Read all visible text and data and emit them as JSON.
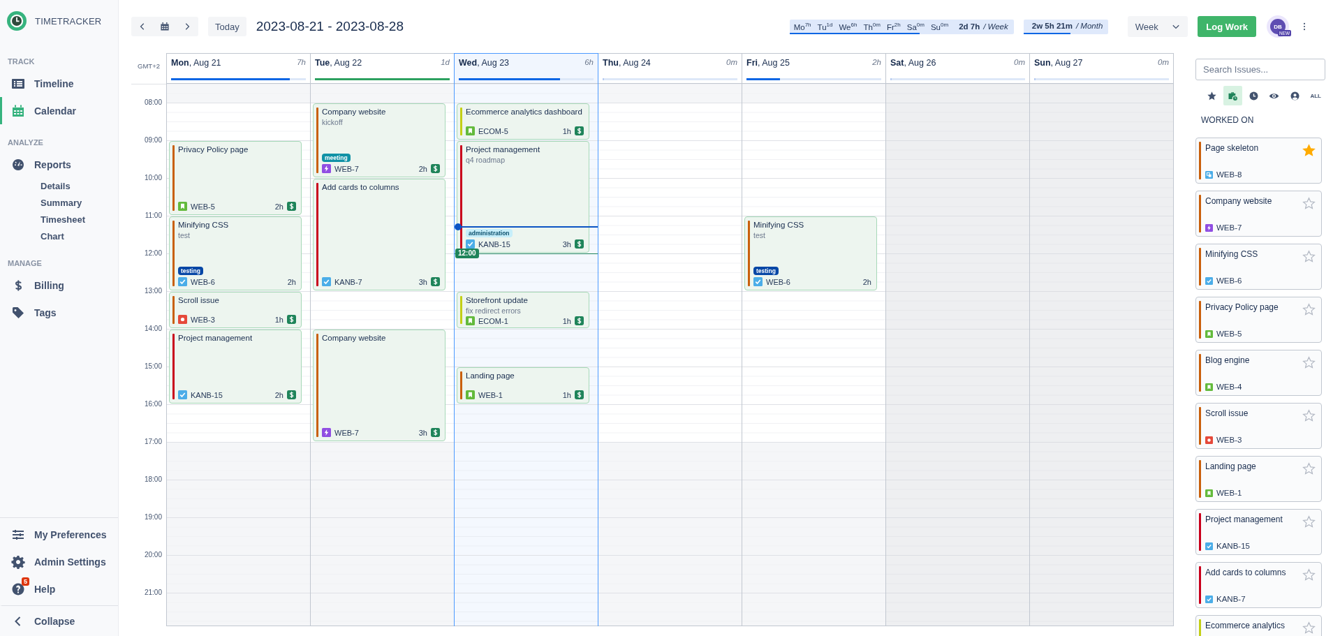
{
  "app": {
    "name": "TIMETRACKER"
  },
  "sidebar": {
    "sections": [
      {
        "title": "TRACK",
        "items": [
          {
            "label": "Timeline",
            "selected": false
          },
          {
            "label": "Calendar",
            "selected": true
          }
        ]
      },
      {
        "title": "ANALYZE",
        "items": [
          {
            "label": "Reports",
            "selected": false,
            "children": [
              {
                "label": "Details",
                "selected": false
              },
              {
                "label": "Summary",
                "selected": false
              },
              {
                "label": "Timesheet",
                "selected": false
              },
              {
                "label": "Chart",
                "selected": false
              }
            ]
          }
        ]
      },
      {
        "title": "MANAGE",
        "items": [
          {
            "label": "Billing",
            "selected": false
          },
          {
            "label": "Tags",
            "selected": false
          }
        ]
      }
    ],
    "footer": [
      {
        "label": "My Preferences"
      },
      {
        "label": "Admin Settings"
      },
      {
        "label": "Help",
        "badge": "5"
      }
    ],
    "collapse": "Collapse"
  },
  "toolbar": {
    "today": "Today",
    "range": "2023-08-21 - 2023-08-28",
    "week_summary": {
      "days": [
        {
          "label": "Mo",
          "value": "7h"
        },
        {
          "label": "Tu",
          "value": "1d"
        },
        {
          "label": "We",
          "value": "6h"
        },
        {
          "label": "Th",
          "value": "0m"
        },
        {
          "label": "Fr",
          "value": "2h"
        },
        {
          "label": "Sa",
          "value": "0m"
        },
        {
          "label": "Su",
          "value": "0m"
        }
      ],
      "total": "2d 7h",
      "unit": "/ Week",
      "level": 0.58
    },
    "month_summary": {
      "total": "2w 5h 21m",
      "unit": "/ Month",
      "level": 0.55
    },
    "view": "Week",
    "log_work": "Log Work",
    "user": {
      "initials": "DB",
      "badge": "NEW"
    }
  },
  "calendar": {
    "timezone": "GMT+2",
    "hours": [
      "08:00",
      "09:00",
      "10:00",
      "11:00",
      "12:00",
      "13:00",
      "14:00",
      "15:00",
      "16:00",
      "17:00",
      "18:00",
      "19:00",
      "20:00",
      "21:00"
    ],
    "hover_time": "12:00",
    "days": [
      {
        "label": "**Mon**, Aug 21",
        "total": "7h",
        "level": 0.88,
        "complete": false,
        "selected": false,
        "weekend": false,
        "events": [
          {
            "title": "Privacy Policy page",
            "kind": "story",
            "key": "WEB-5",
            "duration": "2h",
            "billable": true,
            "color": "#c9600c"
          },
          {
            "title": "Minifying CSS",
            "description": "test",
            "tag": {
              "label": "testing",
              "color": "#0747a6"
            },
            "kind": "task",
            "key": "WEB-6",
            "duration": "2h",
            "billable": false,
            "color": "#c9600c"
          },
          {
            "title": "Scroll issue",
            "kind": "bug",
            "key": "WEB-3",
            "duration": "1h",
            "billable": true,
            "color": "#c9600c"
          },
          {
            "title": "Project management",
            "kind": "task",
            "key": "KANB-15",
            "duration": "2h",
            "billable": true,
            "color": "#c9001c"
          }
        ]
      },
      {
        "label": "**Tue**, Aug 22",
        "total": "1d",
        "level": 1,
        "complete": true,
        "selected": false,
        "weekend": false,
        "events": [
          {
            "title": "Company website",
            "description": "kickoff",
            "tag": {
              "label": "meeting",
              "color": "#1192a6"
            },
            "kind": "epic",
            "key": "WEB-7",
            "duration": "2h",
            "billable": true,
            "color": "#c9600c"
          },
          {
            "title": "Add cards to columns",
            "kind": "task",
            "key": "KANB-7",
            "duration": "3h",
            "billable": true,
            "color": "#c9001c"
          },
          {
            "title": "Company website",
            "kind": "epic",
            "key": "WEB-7",
            "duration": "3h",
            "billable": true,
            "color": "#c9600c"
          }
        ]
      },
      {
        "label": "**Wed**, Aug 23",
        "total": "6h",
        "level": 0.75,
        "complete": false,
        "selected": true,
        "weekend": false,
        "events": [
          {
            "title": "Ecommerce analytics dashboard",
            "kind": "story",
            "key": "ECOM-5",
            "duration": "1h",
            "billable": true,
            "color": "#c3cf16"
          },
          {
            "title": "Project management",
            "description": "q4 roadmap",
            "tag": {
              "label": "administration",
              "color": "#c6eefa"
            },
            "kind": "task",
            "key": "KANB-15",
            "duration": "3h",
            "billable": true,
            "color": "#c9001c"
          },
          {
            "title": "Storefront update",
            "description": "fix redirect errors",
            "kind": "story",
            "key": "ECOM-1",
            "duration": "1h",
            "billable": true,
            "color": "#c3cf16"
          },
          {
            "title": "Landing page",
            "kind": "story",
            "key": "WEB-1",
            "duration": "1h",
            "billable": true,
            "color": "#c9600c"
          }
        ]
      },
      {
        "label": "**Thu**, Aug 24",
        "total": "0m",
        "level": 0,
        "selected": false,
        "weekend": false
      },
      {
        "label": "**Fri**, Aug 25",
        "total": "2h",
        "level": 0.25,
        "complete": false,
        "selected": false,
        "weekend": false,
        "events": [
          {
            "title": "Minifying CSS",
            "description": "test",
            "tag": {
              "label": "testing",
              "color": "#0747a6"
            },
            "kind": "task",
            "key": "WEB-6",
            "duration": "2h",
            "billable": false,
            "color": "#c9600c"
          }
        ]
      },
      {
        "label": "**Sat**, Aug 26",
        "total": "0m",
        "level": 0,
        "selected": false,
        "weekend": true
      },
      {
        "label": "**Sun**, Aug 27",
        "total": "0m",
        "level": 0,
        "selected": false,
        "weekend": true
      }
    ]
  },
  "issues_panel": {
    "search_placeholder": "Search Issues...",
    "filters": [
      {
        "selected": false
      },
      {
        "selected": true
      },
      {
        "selected": false
      },
      {
        "selected": false
      },
      {
        "selected": false
      },
      {
        "label": "ALL",
        "selected": false
      }
    ],
    "section": "WORKED ON",
    "issues": [
      {
        "title": "Page skeleton",
        "kind": "subtask",
        "key": "WEB-8",
        "color": "#c9600c",
        "starred": true
      },
      {
        "title": "Company website",
        "kind": "epic",
        "key": "WEB-7",
        "color": "#c9600c",
        "starred": false
      },
      {
        "title": "Minifying CSS",
        "kind": "task",
        "key": "WEB-6",
        "color": "#c9600c",
        "starred": false
      },
      {
        "title": "Privacy Policy page",
        "kind": "story",
        "key": "WEB-5",
        "color": "#c9600c",
        "starred": false
      },
      {
        "title": "Blog engine",
        "kind": "story",
        "key": "WEB-4",
        "color": "#c9600c",
        "starred": false
      },
      {
        "title": "Scroll issue",
        "kind": "bug",
        "key": "WEB-3",
        "color": "#c9600c",
        "starred": false
      },
      {
        "title": "Landing page",
        "kind": "story",
        "key": "WEB-1",
        "color": "#c9600c",
        "starred": false
      },
      {
        "title": "Project management",
        "kind": "task",
        "key": "KANB-15",
        "color": "#c9001c",
        "starred": false
      },
      {
        "title": "Add cards to columns",
        "kind": "task",
        "key": "KANB-7",
        "color": "#c9001c",
        "starred": false
      },
      {
        "title": "Ecommerce analytics",
        "color": "#c3cf16",
        "starred": false
      }
    ]
  }
}
